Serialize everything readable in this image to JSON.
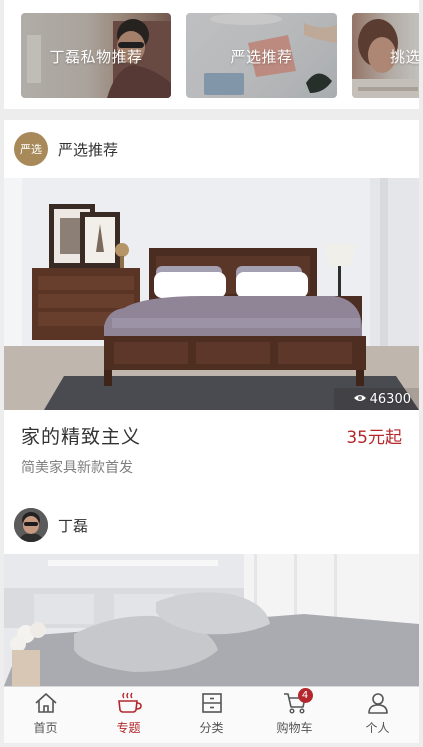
{
  "topics": [
    {
      "label": "丁磊私物推荐"
    },
    {
      "label": "严选推荐"
    },
    {
      "label": "挑选"
    }
  ],
  "posts": [
    {
      "author": {
        "name": "严选推荐",
        "avatar_text": "严选"
      },
      "views": "46300",
      "title": "家的精致主义",
      "price": "35元起",
      "desc": "简美家具新款首发"
    },
    {
      "author": {
        "name": "丁磊"
      }
    }
  ],
  "tabbar": {
    "items": [
      {
        "label": "首页",
        "icon": "home-icon"
      },
      {
        "label": "专题",
        "icon": "cup-icon"
      },
      {
        "label": "分类",
        "icon": "category-icon"
      },
      {
        "label": "购物车",
        "icon": "cart-icon"
      },
      {
        "label": "个人",
        "icon": "profile-icon"
      }
    ],
    "active_index": 1,
    "cart_badge": "4"
  },
  "colors": {
    "accent": "#b4282d",
    "background": "#ededed",
    "price": "#b4282d"
  }
}
